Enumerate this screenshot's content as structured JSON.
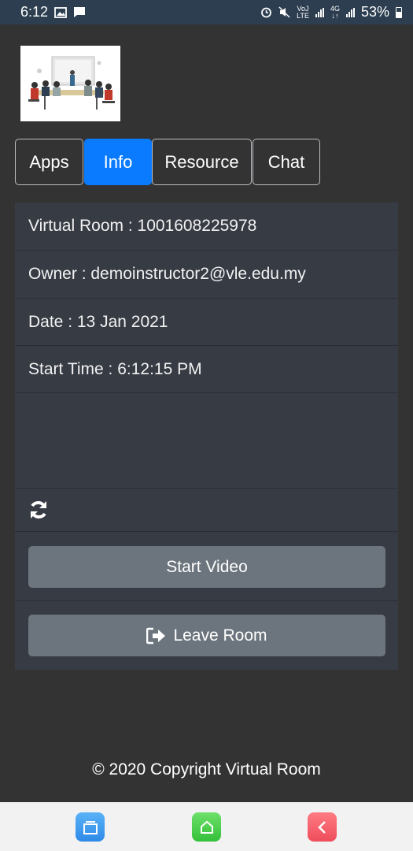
{
  "status_bar": {
    "time": "6:12",
    "battery": "53%",
    "icons": [
      "image-icon",
      "message-icon",
      "alarm-icon",
      "mute-icon",
      "volte-icon",
      "signal-icon",
      "4g-icon",
      "signal-icon",
      "battery-icon"
    ]
  },
  "tabs": [
    {
      "label": "Apps",
      "active": false
    },
    {
      "label": "Info",
      "active": true
    },
    {
      "label": "Resource",
      "active": false
    },
    {
      "label": "Chat",
      "active": false
    }
  ],
  "info": {
    "virtual_room_label": "Virtual Room",
    "virtual_room_value": "1001608225978",
    "owner_label": "Owner",
    "owner_value": "demoinstructor2@vle.edu.my",
    "date_label": "Date",
    "date_value": "13 Jan 2021",
    "start_time_label": "Start Time",
    "start_time_value": "6:12:15 PM"
  },
  "actions": {
    "start_video": "Start Video",
    "leave_room": "Leave Room"
  },
  "footer": {
    "copyright": "© 2020 Copyright Virtual Room"
  },
  "colors": {
    "background": "#333333",
    "panel": "#373b44",
    "active_tab": "#0a7bff",
    "button": "#6c757d"
  }
}
